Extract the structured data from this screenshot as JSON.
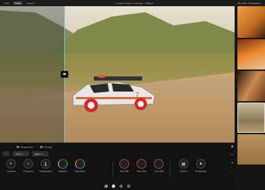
{
  "topbar": {
    "tabs": [
      {
        "label": "Edit",
        "active": false
      },
      {
        "label": "Color",
        "active": true
      },
      {
        "label": "Export",
        "active": false
      }
    ],
    "center_title": "Linear Rover Concept · Edited",
    "right_title": "All Main Sequence"
  },
  "panel": {
    "sequence_label": "Sequence",
    "group_label": "Group",
    "layers": [
      {
        "label": "Node 1"
      },
      {
        "label": "Node 2"
      }
    ],
    "tool_groups": [
      [
        {
          "label": "Contrast",
          "icon": "contrast-icon",
          "glyph": "◐"
        },
        {
          "label": "Exposure",
          "icon": "exposure-icon",
          "glyph": "☼"
        },
        {
          "label": "Temperature",
          "icon": "thermometer-icon",
          "glyph": "🌡"
        },
        {
          "label": "Balance",
          "icon": "color-wheel-icon",
          "glyph": "◎"
        },
        {
          "label": "Saturation",
          "icon": "color-wheel-icon",
          "glyph": "◎"
        }
      ],
      [
        {
          "label": "Sat Shift",
          "icon": "wheel-icon",
          "glyph": "◯"
        },
        {
          "label": "Hue Shift",
          "icon": "wheel-icon",
          "glyph": "◯"
        },
        {
          "label": "Lum Shift",
          "icon": "wheel-icon",
          "glyph": "◯"
        }
      ],
      [
        {
          "label": "Texture",
          "icon": "texture-icon",
          "glyph": "▦"
        },
        {
          "label": "Sharpness",
          "icon": "sharpness-icon",
          "glyph": "▲"
        }
      ]
    ]
  },
  "colors": {
    "split_line": "#5fd3d8",
    "active_tab": "#3a3a3a"
  }
}
